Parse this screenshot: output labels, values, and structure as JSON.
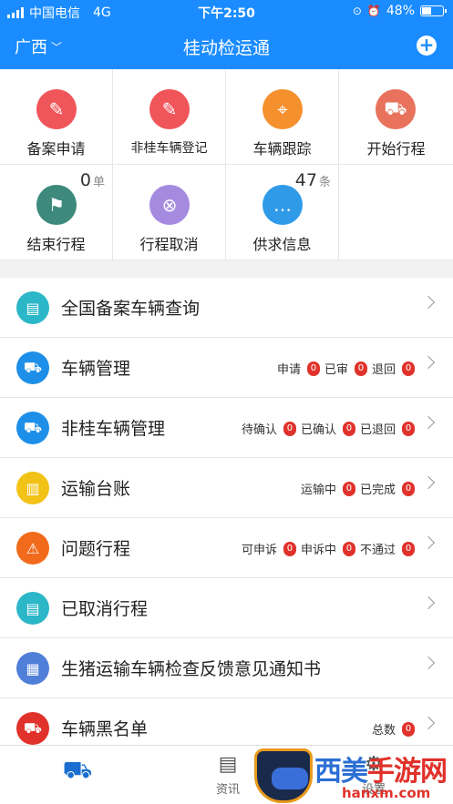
{
  "status": {
    "carrier": "中国电信",
    "network": "4G",
    "time": "下午2:50",
    "battery": "48%"
  },
  "nav": {
    "region": "广西",
    "title": "桂动检运通"
  },
  "grid": [
    {
      "label": "备案申请"
    },
    {
      "label": "非桂车辆登记"
    },
    {
      "label": "车辆跟踪"
    },
    {
      "label": "开始行程"
    },
    {
      "label": "结束行程",
      "count": "0",
      "unit": "单"
    },
    {
      "label": "行程取消"
    },
    {
      "label": "供求信息",
      "count": "47",
      "unit": "条"
    }
  ],
  "list": [
    {
      "label": "全国备案车辆查询"
    },
    {
      "label": "车辆管理",
      "stats": [
        {
          "label": "申请",
          "count": "0"
        },
        {
          "label": "已审",
          "count": "0"
        },
        {
          "label": "退回",
          "count": "0"
        }
      ]
    },
    {
      "label": "非桂车辆管理",
      "stats": [
        {
          "label": "待确认",
          "count": "0"
        },
        {
          "label": "已确认",
          "count": "0"
        },
        {
          "label": "已退回",
          "count": "0"
        }
      ]
    },
    {
      "label": "运输台账",
      "stats": [
        {
          "label": "运输中",
          "count": "0"
        },
        {
          "label": "已完成",
          "count": "0"
        }
      ]
    },
    {
      "label": "问题行程",
      "stats": [
        {
          "label": "可申诉",
          "count": "0"
        },
        {
          "label": "申诉中",
          "count": "0"
        },
        {
          "label": "不通过",
          "count": "0"
        }
      ]
    },
    {
      "label": "已取消行程"
    },
    {
      "label": "生猪运输车辆检查反馈意见通知书"
    },
    {
      "label": "车辆黑名单",
      "stats": [
        {
          "label": "总数",
          "count": "0"
        }
      ]
    }
  ],
  "tabs": {
    "news": "资讯",
    "settings": "设置"
  },
  "watermark": {
    "title_a": "西美",
    "title_b": "手游网",
    "url": "hanxm.com"
  },
  "colors": {
    "primary": "#1a8cff",
    "badge": "#e0322b"
  }
}
